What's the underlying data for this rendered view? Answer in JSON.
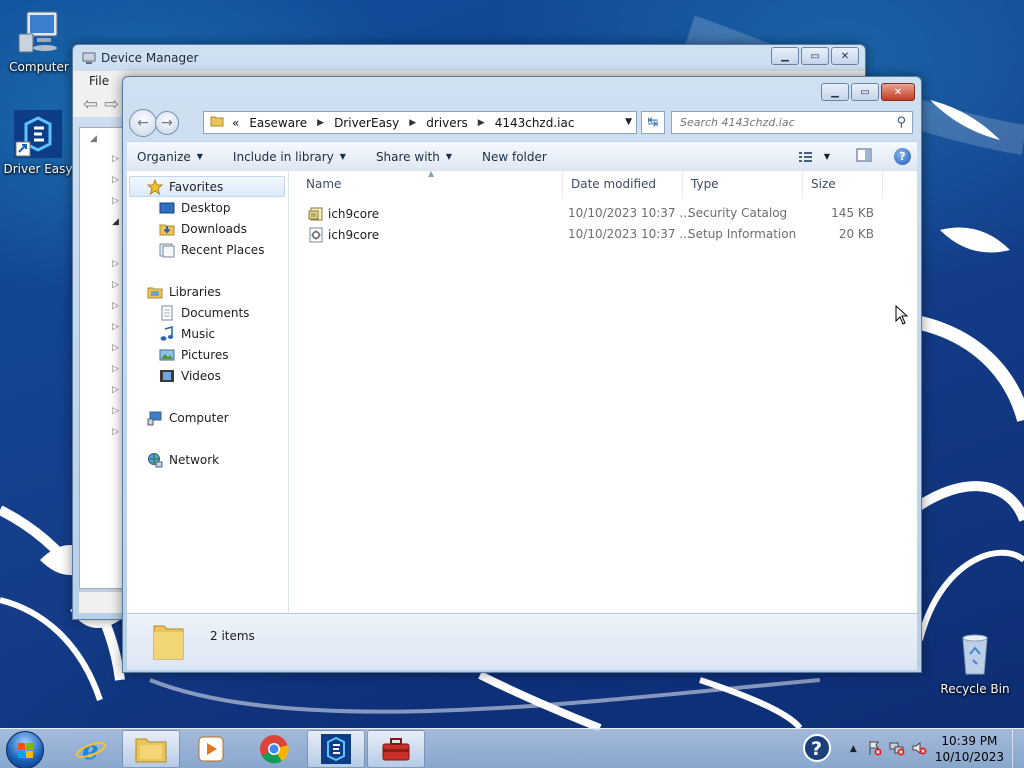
{
  "desktop": {
    "icons": {
      "computer": "Computer",
      "driver_easy": "Driver Easy",
      "recycle_bin": "Recycle Bin"
    }
  },
  "device_manager": {
    "title": "Device Manager",
    "menu_file": "File"
  },
  "explorer": {
    "breadcrumb": [
      "«",
      "Easeware",
      "DriverEasy",
      "drivers",
      "4143chzd.iac"
    ],
    "search_placeholder": "Search 4143chzd.iac",
    "toolbar": {
      "organize": "Organize",
      "include_in_library": "Include in library",
      "share_with": "Share with",
      "new_folder": "New folder"
    },
    "nav": {
      "favorites": "Favorites",
      "desktop": "Desktop",
      "downloads": "Downloads",
      "recent_places": "Recent Places",
      "libraries": "Libraries",
      "documents": "Documents",
      "music": "Music",
      "pictures": "Pictures",
      "videos": "Videos",
      "computer": "Computer",
      "network": "Network"
    },
    "columns": {
      "name": "Name",
      "date_modified": "Date modified",
      "type": "Type",
      "size": "Size"
    },
    "files": [
      {
        "name": "ich9core",
        "date": "10/10/2023 10:37 ...",
        "type": "Security Catalog",
        "size": "145 KB",
        "icon": "security-catalog-icon"
      },
      {
        "name": "ich9core",
        "date": "10/10/2023 10:37 ...",
        "type": "Setup Information",
        "size": "20 KB",
        "icon": "setup-information-icon"
      }
    ],
    "item_count": "2 items"
  },
  "taskbar": {
    "time": "10:39 PM",
    "date": "10/10/2023"
  },
  "colors": {
    "accent": "#1f58b6",
    "window_frame": "#b8cfe8",
    "close_button": "#c43c22"
  }
}
